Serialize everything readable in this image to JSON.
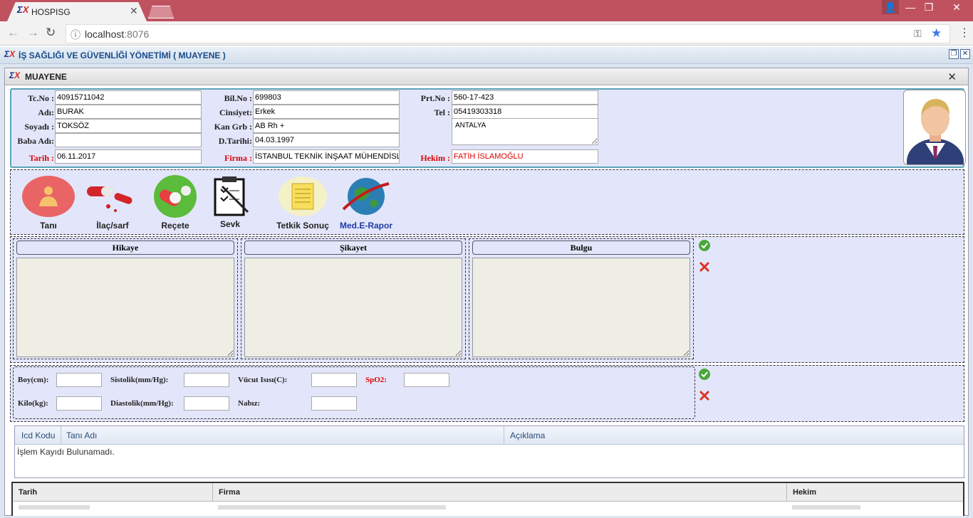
{
  "browser": {
    "tab_title": "HOSPISG",
    "url_host": "localhost",
    "url_port": ":8076"
  },
  "app": {
    "title": "İŞ SAĞLIĞI VE GÜVENLİĞİ YÖNETİMİ ( MUAYENE )",
    "window_title": "MUAYENE"
  },
  "patient": {
    "labels": {
      "tcno": "Tc.No :",
      "adi": "Adı:",
      "soyadi": "Soyadı :",
      "baba_adi": "Baba Adı:",
      "tarih": "Tarih :",
      "bilno": "Bil.No :",
      "cinsiyet": "Cinsiyet:",
      "kan_grb": "Kan Grb :",
      "dtarihi": "D.Tarihi:",
      "firma": "Firma :",
      "prtno": "Prt.No :",
      "tel": "Tel :",
      "hekim": "Hekim :"
    },
    "tcno": "40915711042",
    "adi": "BURAK",
    "soyadi": "TOKSÖZ",
    "baba_adi": "",
    "tarih": "06.11.2017",
    "bilno": "699803",
    "cinsiyet": "Erkek",
    "kan_grb": "AB Rh +",
    "dtarihi": "04.03.1997",
    "firma": "İSTANBUL TEKNİK İNŞAAT MÜHENDİSL",
    "prtno": "560-17-423",
    "tel": "05419303318",
    "adres": "ANTALYA",
    "hekim": "FATİH İSLAMOĞLU"
  },
  "toolbar": {
    "tani": "Tanı",
    "ilac": "İlaç/sarf",
    "recete": "Reçete",
    "sevk": "Sevk",
    "tetkik": "Tetkik Sonuç",
    "medrapor": "Med.E-Rapor"
  },
  "notes": {
    "hikaye": "Hikaye",
    "sikayet": "Şikayet",
    "bulgu": "Bulgu"
  },
  "vitals": {
    "boy": "Boy(cm):",
    "kilo": "Kilo(kg):",
    "sistolik": "Sistolik(mm/Hg):",
    "diastolik": "Diastolik(mm/Hg):",
    "vucut": "Vücut Isısı(C):",
    "nabiz": "Nabız:",
    "spo2": "SpO2:"
  },
  "diagnosis_grid": {
    "columns": [
      "Icd Kodu",
      "Tanı Adı",
      "Açıklama"
    ],
    "empty_text": "İşlem Kayıdı Bulunamadı."
  },
  "history_grid": {
    "columns": [
      "Tarih",
      "Firma",
      "Hekim"
    ]
  },
  "colors": {
    "titlebar": "#c0525f",
    "panel": "#e3e6fa",
    "accent_red": "#dd0000",
    "accent_blue": "#1d3aa8"
  }
}
